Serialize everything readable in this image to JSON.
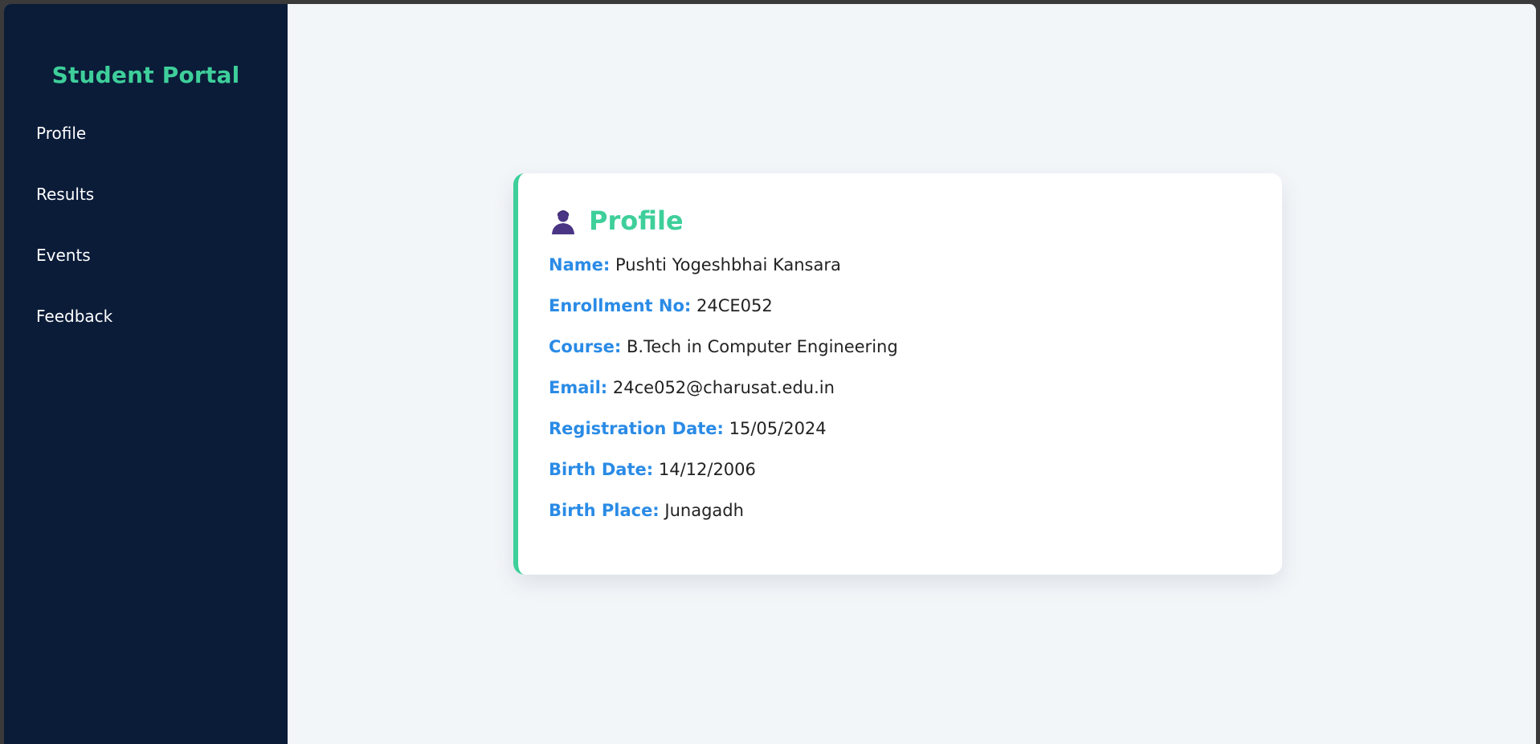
{
  "sidebar": {
    "brand": "Student Portal",
    "items": [
      {
        "label": "Profile"
      },
      {
        "label": "Results"
      },
      {
        "label": "Events"
      },
      {
        "label": "Feedback"
      }
    ]
  },
  "profile": {
    "title": "Profile",
    "icon": "user-icon",
    "fields": [
      {
        "label": "Name:",
        "value": "Pushti Yogeshbhai Kansara"
      },
      {
        "label": "Enrollment No:",
        "value": "24CE052"
      },
      {
        "label": "Course:",
        "value": "B.Tech in Computer Engineering"
      },
      {
        "label": "Email:",
        "value": "24ce052@charusat.edu.in"
      },
      {
        "label": "Registration Date:",
        "value": "15/05/2024"
      },
      {
        "label": "Birth Date:",
        "value": "14/12/2006"
      },
      {
        "label": "Birth Place:",
        "value": "Junagadh"
      }
    ]
  },
  "colors": {
    "sidebar_bg": "#0b1c39",
    "accent": "#3ecf9a",
    "label_blue": "#2a8be6",
    "page_bg": "#f3f6f9"
  }
}
